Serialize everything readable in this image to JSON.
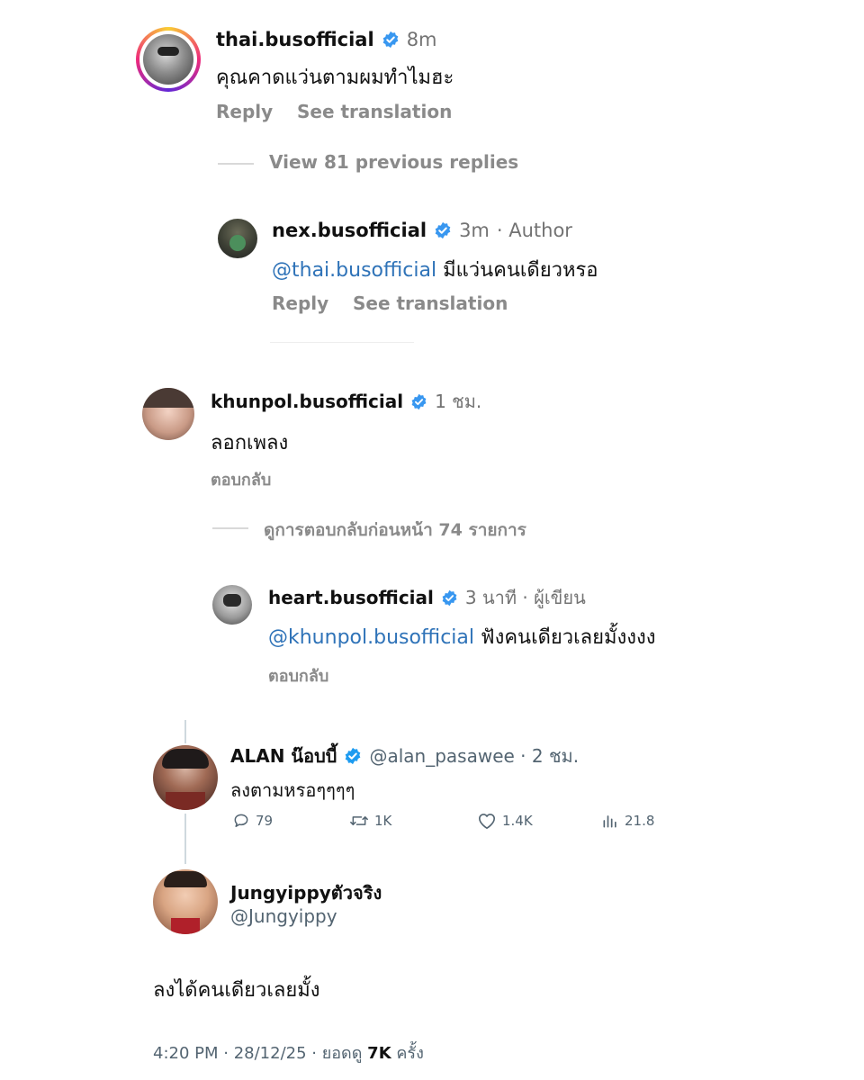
{
  "colors": {
    "verified": "#3897f0",
    "x_verified": "#1d9bf0",
    "mention": "#2f73b8",
    "meta": "#737373",
    "ring_start": "#f9ce34",
    "ring_mid": "#ee2a7b",
    "ring_end": "#6228d7"
  },
  "ig1": {
    "comment": {
      "username": "thai.busofficial",
      "time": "8m",
      "text": "คุณคาดแว่นตามผมทำไมฮะ",
      "reply": "Reply",
      "see_translation": "See translation"
    },
    "view_prev": "View 81 previous replies",
    "reply": {
      "username": "nex.busofficial",
      "time": "3m",
      "author": "· Author",
      "mention": "@thai.busofficial",
      "text": "มีแว่นคนเดียวหรอ",
      "reply": "Reply",
      "see_translation": "See translation"
    }
  },
  "ig2": {
    "comment": {
      "username": "khunpol.busofficial",
      "time": "1 ชม.",
      "text": "ลอกเพลง",
      "reply": "ตอบกลับ"
    },
    "view_prev": "ดูการตอบกลับก่อนหน้า 74 รายการ",
    "reply": {
      "username": "heart.busofficial",
      "time": "3 นาที · ผู้เขียน",
      "mention": "@khunpol.busofficial",
      "text": "ฟังคนเดียวเลยมั้งงงง",
      "reply": "ตอบกลับ"
    }
  },
  "x_post": {
    "display_name": "ALAN น๊อบบี้",
    "handle_time": "@alan_pasawee · 2 ชม.",
    "text": "ลงตามหรอๆๆๆๆ",
    "stats": {
      "replies": "79",
      "reposts": "1K",
      "likes": "1.4K",
      "views": "21.8"
    },
    "icons": [
      "reply-icon",
      "repost-icon",
      "like-icon",
      "views-icon"
    ]
  },
  "x_reply": {
    "display_name": "Jungyippyตัวจริง",
    "handle": "@Jungyippy",
    "text": "ลงได้คนเดียวเลยมั้ง",
    "footer": {
      "time_date": "4:20 PM · 28/12/25 · ยอดดู",
      "views": "7K",
      "suffix": "ครั้ง"
    }
  }
}
